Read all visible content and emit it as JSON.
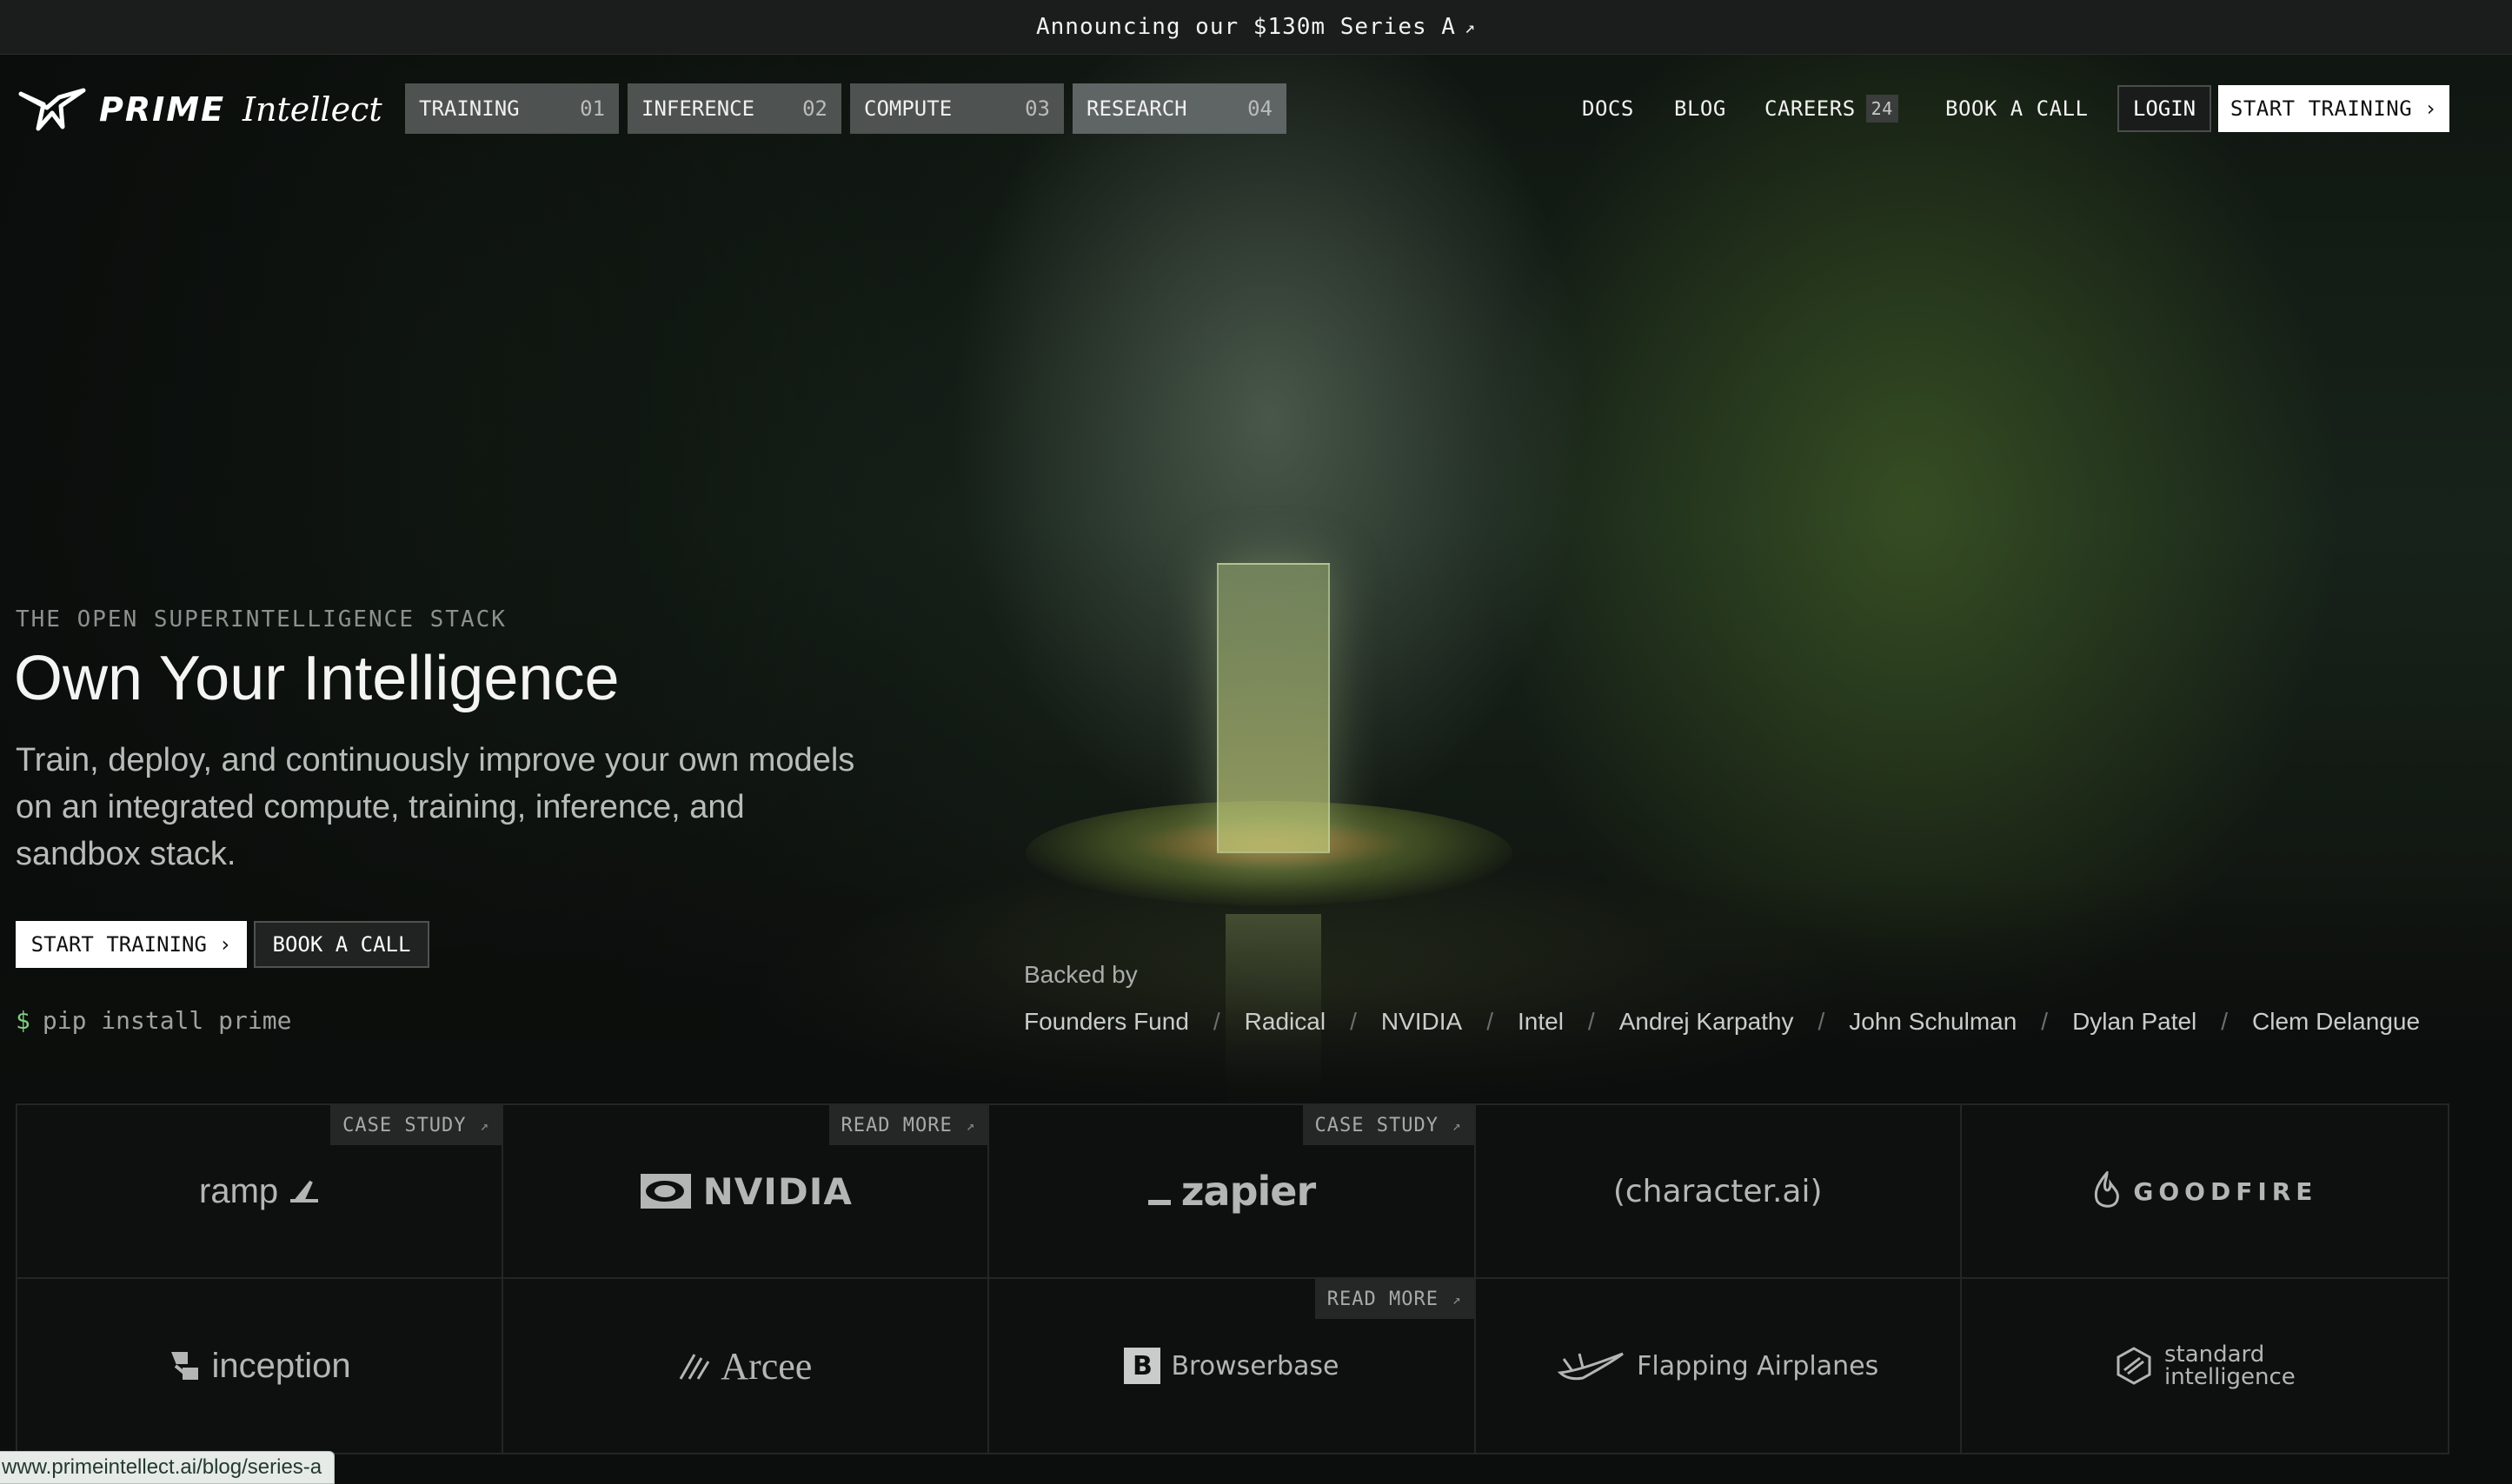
{
  "announcement": {
    "text": "Announcing our $130m Series A",
    "arrow": "↗"
  },
  "brand": {
    "prime": "PRIME",
    "intellect": "Intellect"
  },
  "nav": {
    "tabs": [
      {
        "label": "TRAINING",
        "num": "01"
      },
      {
        "label": "INFERENCE",
        "num": "02"
      },
      {
        "label": "COMPUTE",
        "num": "03"
      },
      {
        "label": "RESEARCH",
        "num": "04"
      }
    ],
    "links": {
      "docs": "DOCS",
      "blog": "BLOG",
      "careers": "CAREERS",
      "careers_count": "24",
      "book_call": "BOOK A CALL"
    },
    "login": "LOGIN",
    "start_training": "START TRAINING",
    "chevron": "›"
  },
  "hero": {
    "eyebrow": "THE OPEN SUPERINTELLIGENCE STACK",
    "title": "Own Your Intelligence",
    "subtitle": "Train, deploy, and continuously improve your own models on an integrated compute, training, inference, and sandbox stack.",
    "start_training": "START TRAINING",
    "book_call": "BOOK A CALL",
    "pip_prompt": "$",
    "pip_command": "pip install prime"
  },
  "backed": {
    "label": "Backed by",
    "separator": "/",
    "names": [
      "Founders Fund",
      "Radical",
      "NVIDIA",
      "Intel",
      "Andrej Karpathy",
      "John Schulman",
      "Dylan Patel",
      "Clem Delangue"
    ]
  },
  "logos": {
    "tags": {
      "case_study": "CASE STUDY",
      "read_more": "READ MORE",
      "arrow": "↗"
    },
    "row1": [
      "ramp",
      "NVIDIA",
      "zapier",
      "(character.ai)",
      "GOODFIRE"
    ],
    "row2": [
      "inception",
      "Arcee",
      "Browserbase",
      "Flapping Airplanes",
      "standard",
      "intelligence"
    ],
    "browserbase_mark": "B"
  },
  "status_url": "www.primeintellect.ai/blog/series-a",
  "colors": {
    "background": "#0c0e0d",
    "tab": "#4e5250",
    "button": "#ffffff",
    "accent_prompt": "#7fcf7f"
  }
}
